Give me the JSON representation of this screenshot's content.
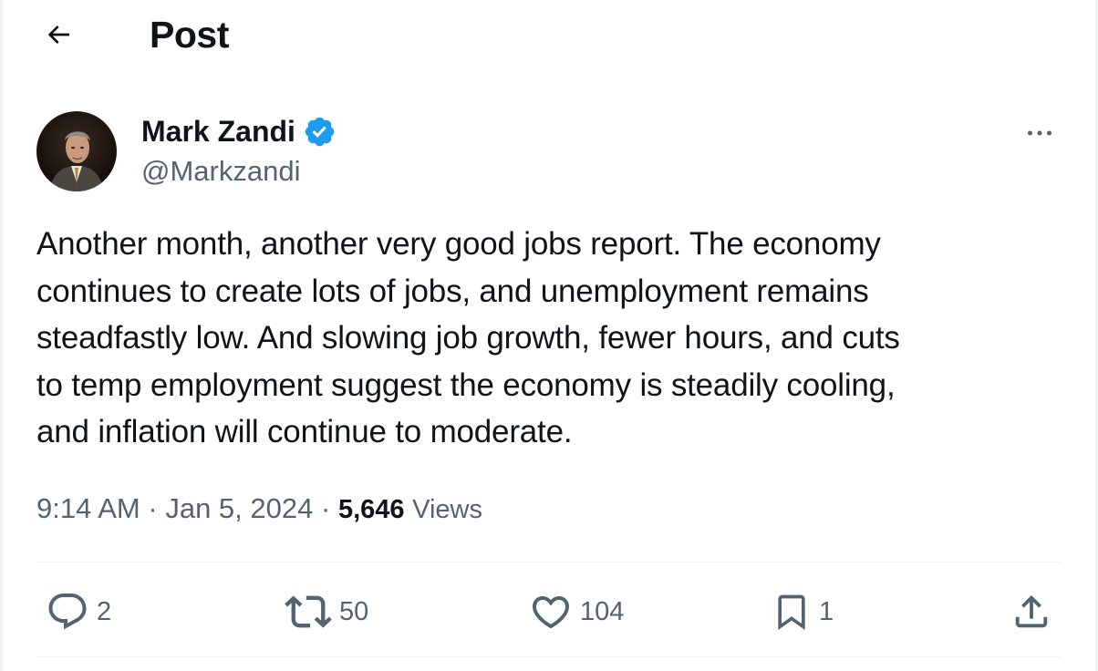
{
  "header": {
    "title": "Post"
  },
  "author": {
    "name": "Mark Zandi",
    "handle": "@Markzandi",
    "verified": true
  },
  "tweet": {
    "text": "Another month, another very good jobs report. The economy\ncontinues to create lots of jobs, and unemployment remains\nsteadfastly low. And slowing job growth, fewer hours, and cuts\nto temp employment suggest the economy is steadily cooling,\nand inflation will continue to moderate.",
    "time": "9:14 AM",
    "date": "Jan 5, 2024",
    "separator": "·",
    "views_count": "5,646",
    "views_label": "Views"
  },
  "actions": {
    "replies": "2",
    "reposts": "50",
    "likes": "104",
    "bookmarks": "1"
  },
  "icons": {
    "back": "arrow-left-icon",
    "verified": "verified-badge-icon",
    "more": "more-horizontal-icon",
    "reply": "reply-icon",
    "repost": "repost-icon",
    "like": "heart-icon",
    "bookmark": "bookmark-icon",
    "share": "share-icon"
  },
  "colors": {
    "verified": "#1d9bf0",
    "text": "#0f1419",
    "secondary": "#536471",
    "divider": "#eff3f4"
  }
}
